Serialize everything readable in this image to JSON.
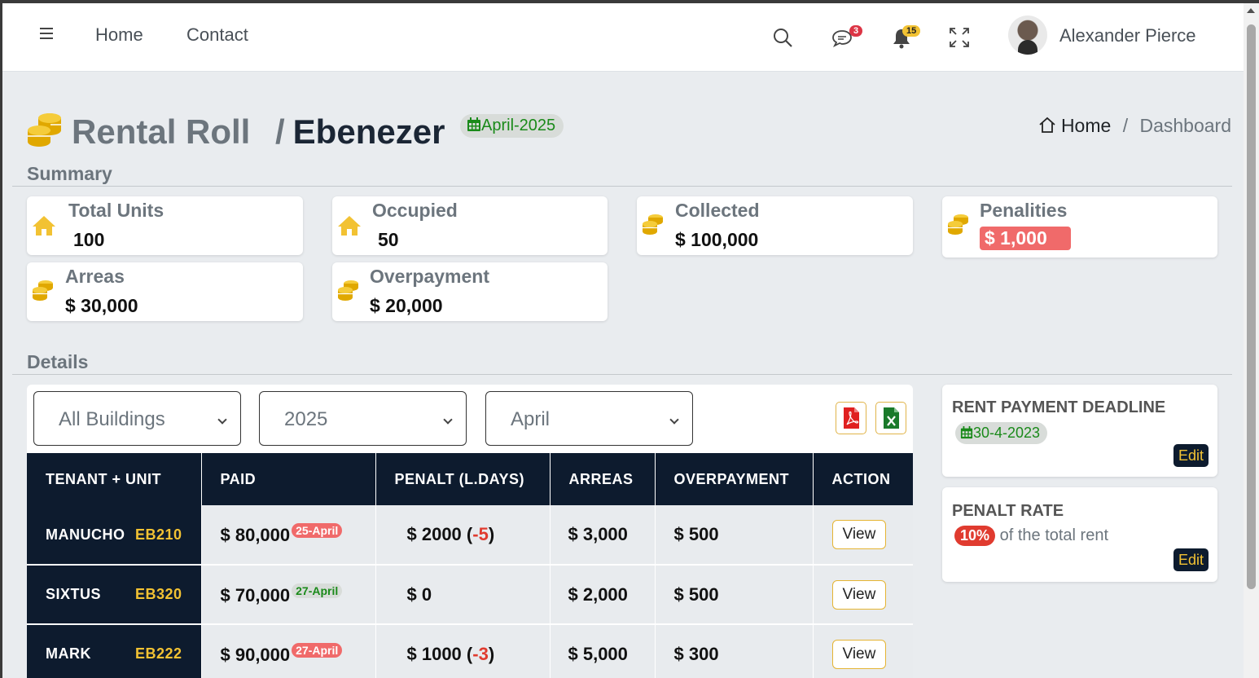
{
  "navbar": {
    "home_label": "Home",
    "contact_label": "Contact",
    "messages_count": "3",
    "notifications_count": "15",
    "user_name": "Alexander Pierce"
  },
  "header": {
    "title": "Rental Roll",
    "subtitle": "Ebenezer",
    "period": "April-2025",
    "breadcrumb": {
      "home": "Home",
      "current": "Dashboard"
    }
  },
  "summary": {
    "title": "Summary",
    "cards": [
      {
        "label": "Total Units",
        "value": "100",
        "icon": "home-icon"
      },
      {
        "label": "Occupied",
        "value": "50",
        "icon": "home-icon"
      },
      {
        "label": "Collected",
        "value": "$ 100,000",
        "icon": "coins-icon"
      },
      {
        "label": "Penalities",
        "value": "$ 1,000",
        "icon": "coins-icon"
      },
      {
        "label": "Arreas",
        "value": "$ 30,000",
        "icon": "coins-icon"
      },
      {
        "label": "Overpayment",
        "value": "$ 20,000",
        "icon": "coins-icon"
      }
    ]
  },
  "details": {
    "title": "Details",
    "filters": {
      "building": "All Buildings",
      "year": "2025",
      "month": "April"
    },
    "columns": [
      "TENANT + UNIT",
      "PAID",
      "PENALT (L.DAYS)",
      "ARREAS",
      "OVERPAYMENT",
      "ACTION"
    ],
    "rows": [
      {
        "tenant": "MANUCHO",
        "unit": "EB210",
        "paid": "$ 80,000",
        "paid_date": "25-April",
        "late": true,
        "penalty": "$ 2000",
        "penalty_days": "-5",
        "arreas": "$  3,000",
        "overpayment": "$  500",
        "action": "View"
      },
      {
        "tenant": "SIXTUS",
        "unit": "EB320",
        "paid": "$ 70,000",
        "paid_date": "27-April",
        "late": false,
        "penalty": "$ 0",
        "penalty_days": "",
        "arreas": "$ 2,000",
        "overpayment": "$  500",
        "action": "View"
      },
      {
        "tenant": "MARK",
        "unit": "EB222",
        "paid": "$ 90,000",
        "paid_date": "27-April",
        "late": true,
        "penalty": "$ 1000",
        "penalty_days": "-3",
        "arreas": "$ 5,000",
        "overpayment": "$ 300",
        "action": "View"
      }
    ]
  },
  "sidebar": {
    "deadline": {
      "title": "RENT PAYMENT DEADLINE",
      "date": "30-4-2023",
      "edit": "Edit"
    },
    "penalty_rate": {
      "title": "PENALT RATE",
      "rate": "10%",
      "text": "of the total rent",
      "edit": "Edit"
    }
  },
  "colors": {
    "dark_navy": "#0d1b2e",
    "gold": "#f2c233",
    "late_red": "#f06a6a",
    "ok_green": "#1a8a1a"
  }
}
